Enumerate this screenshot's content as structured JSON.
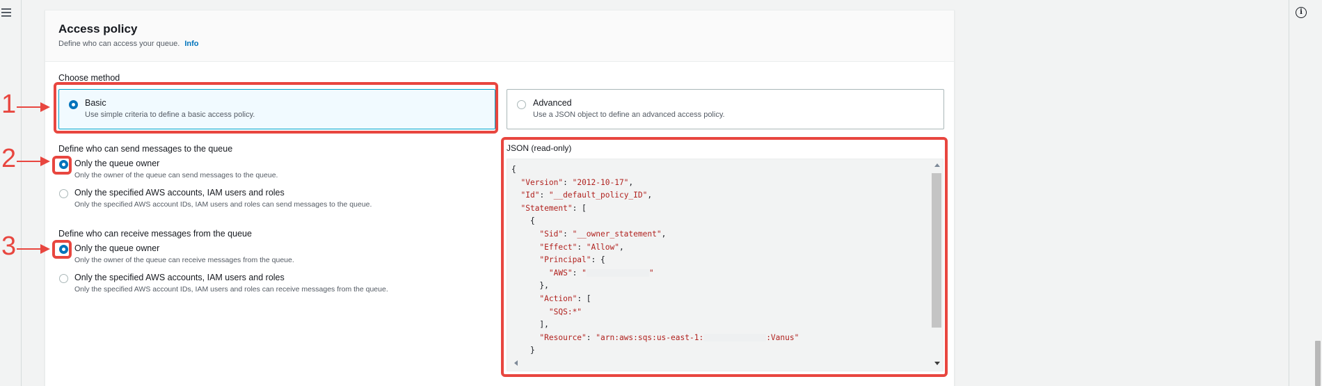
{
  "panel": {
    "title": "Access policy",
    "description": "Define who can access your queue.",
    "info_link": "Info"
  },
  "method": {
    "label": "Choose method",
    "options": [
      {
        "title": "Basic",
        "description": "Use simple criteria to define a basic access policy.",
        "selected": true
      },
      {
        "title": "Advanced",
        "description": "Use a JSON object to define an advanced access policy.",
        "selected": false
      }
    ]
  },
  "send": {
    "label": "Define who can send messages to the queue",
    "options": [
      {
        "title": "Only the queue owner",
        "description": "Only the owner of the queue can send messages to the queue.",
        "selected": true
      },
      {
        "title": "Only the specified AWS accounts, IAM users and roles",
        "description": "Only the specified AWS account IDs, IAM users and roles can send messages to the queue.",
        "selected": false
      }
    ]
  },
  "receive": {
    "label": "Define who can receive messages from the queue",
    "options": [
      {
        "title": "Only the queue owner",
        "description": "Only the owner of the queue can receive messages from the queue.",
        "selected": true
      },
      {
        "title": "Only the specified AWS accounts, IAM users and roles",
        "description": "Only the specified AWS account IDs, IAM users and roles can receive messages from the queue.",
        "selected": false
      }
    ]
  },
  "json_editor": {
    "label": "JSON (read-only)",
    "lines": [
      "{",
      "  \"Version\": \"2012-10-17\",",
      "  \"Id\": \"__default_policy_ID\",",
      "  \"Statement\": [",
      "    {",
      "      \"Sid\": \"__owner_statement\",",
      "      \"Effect\": \"Allow\",",
      "      \"Principal\": {",
      "        \"AWS\": \"[redacted]\"",
      "      },",
      "      \"Action\": [",
      "        \"SQS:*\"",
      "      ],",
      "      \"Resource\": \"arn:aws:sqs:us-east-1:[redacted]:Vanus\"",
      "    }"
    ]
  },
  "annotations": [
    "1",
    "2",
    "3"
  ],
  "colors": {
    "accent": "#0073bb",
    "annotation": "#e8463f",
    "json_string": "#b0211e"
  },
  "icons": {
    "menu": "hamburger-icon",
    "info": "info-icon"
  }
}
